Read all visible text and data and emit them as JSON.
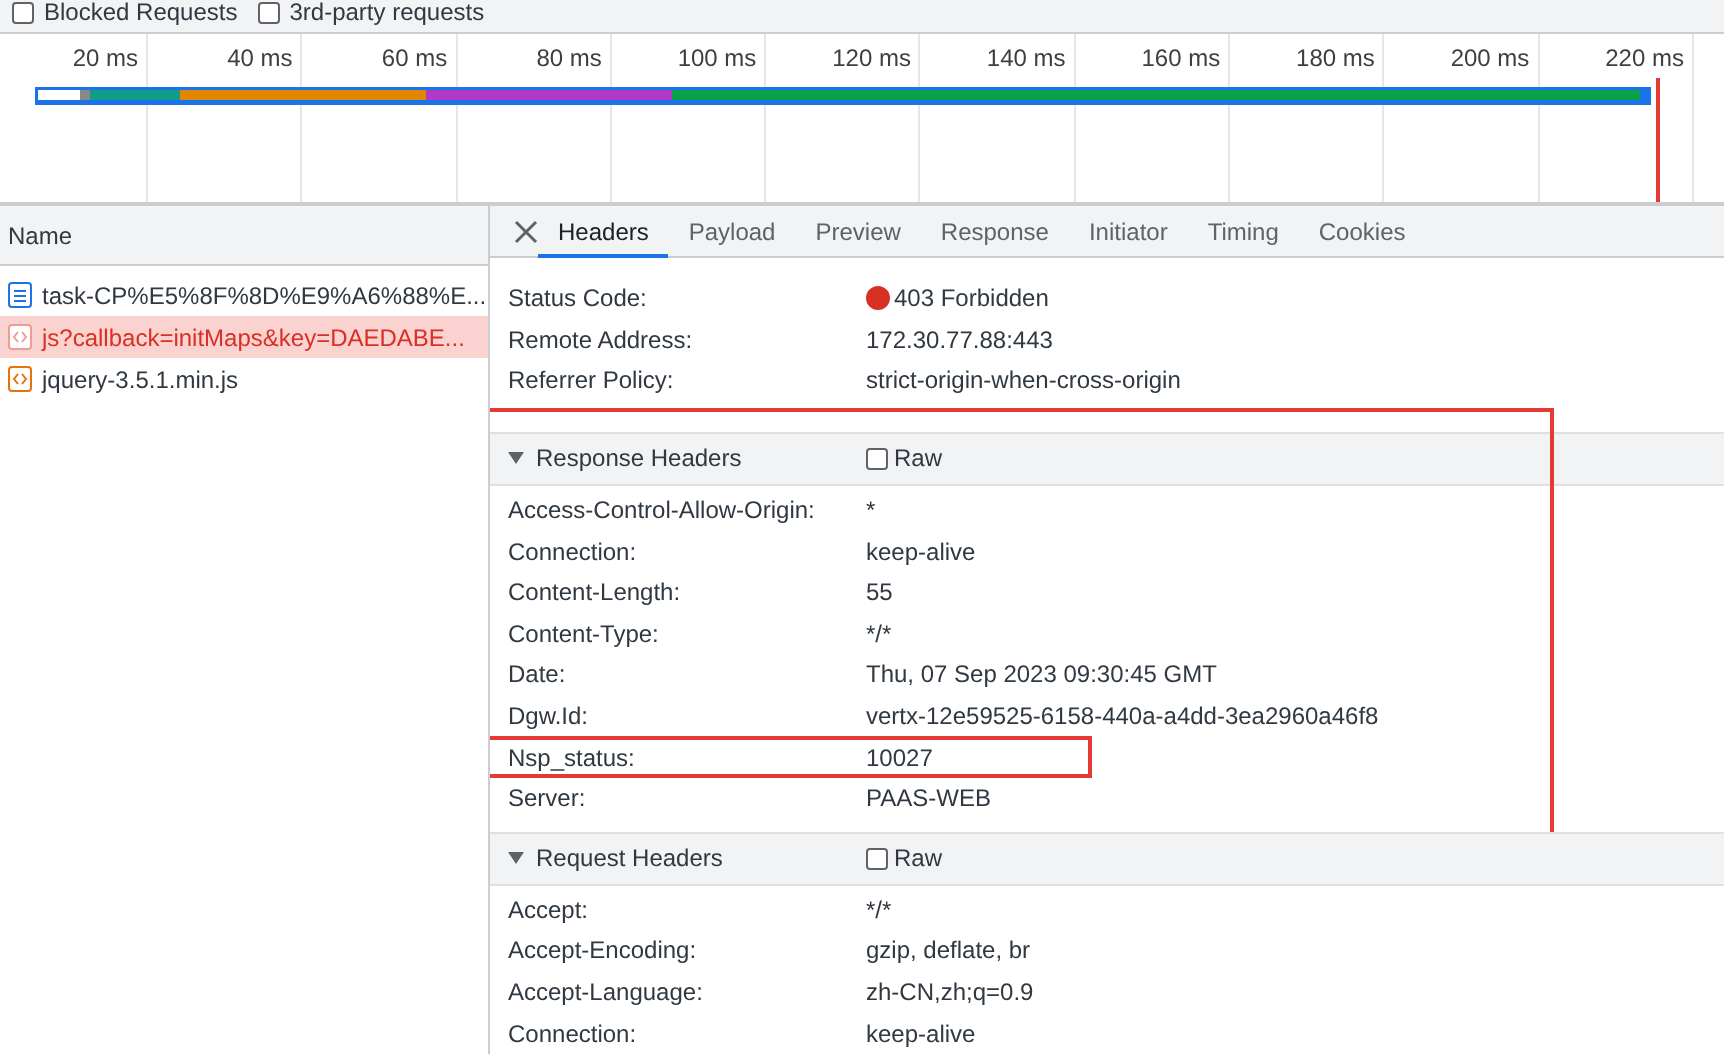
{
  "filters": [
    {
      "label": "Blocked Requests",
      "checked": false
    },
    {
      "label": "3rd-party requests",
      "checked": false
    }
  ],
  "overview": {
    "ticks": [
      "20 ms",
      "40 ms",
      "60 ms",
      "80 ms",
      "100 ms",
      "120 ms",
      "140 ms",
      "160 ms",
      "180 ms",
      "200 ms",
      "220 ms"
    ]
  },
  "requests": {
    "header": "Name",
    "items": [
      {
        "name": "task-CP%E5%8F%8D%E9%A6%88%E...",
        "kind": "document",
        "selected": false,
        "failed": false
      },
      {
        "name": "js?callback=initMaps&key=DAEDABE...",
        "kind": "script",
        "selected": true,
        "failed": true
      },
      {
        "name": "jquery-3.5.1.min.js",
        "kind": "script",
        "selected": false,
        "failed": false
      }
    ]
  },
  "details": {
    "tabs": [
      {
        "label": "Headers",
        "selected": true
      },
      {
        "label": "Payload",
        "selected": false
      },
      {
        "label": "Preview",
        "selected": false
      },
      {
        "label": "Response",
        "selected": false
      },
      {
        "label": "Initiator",
        "selected": false
      },
      {
        "label": "Timing",
        "selected": false
      },
      {
        "label": "Cookies",
        "selected": false
      }
    ],
    "general": [
      {
        "label": "Status Code:",
        "value": "403 Forbidden",
        "color": "#d93025"
      },
      {
        "label": "Remote Address:",
        "value": "172.30.77.88:443"
      },
      {
        "label": "Referrer Policy:",
        "value": "strict-origin-when-cross-origin"
      }
    ],
    "sections": [
      {
        "title": "Response Headers",
        "expanded": true,
        "raw_label": "Raw",
        "raw": false,
        "highlighted": true,
        "rows": [
          {
            "label": "Access-Control-Allow-Origin:",
            "value": "*",
            "highlighted": false
          },
          {
            "label": "Connection:",
            "value": "keep-alive",
            "highlighted": false
          },
          {
            "label": "Content-Length:",
            "value": "55",
            "highlighted": false
          },
          {
            "label": "Content-Type:",
            "value": "*/*",
            "highlighted": false
          },
          {
            "label": "Date:",
            "value": "Thu, 07 Sep 2023 09:30:45 GMT",
            "highlighted": false
          },
          {
            "label": "Dgw.Id:",
            "value": "vertx-12e59525-6158-440a-a4dd-3ea2960a46f8",
            "highlighted": false
          },
          {
            "label": "Nsp_status:",
            "value": "10027",
            "highlighted": true
          },
          {
            "label": "Server:",
            "value": "PAAS-WEB",
            "highlighted": false
          }
        ]
      },
      {
        "title": "Request Headers",
        "expanded": true,
        "raw_label": "Raw",
        "raw": false,
        "highlighted": false,
        "rows": [
          {
            "label": "Accept:",
            "value": "*/*",
            "highlighted": false
          },
          {
            "label": "Accept-Encoding:",
            "value": "gzip, deflate, br",
            "highlighted": false
          },
          {
            "label": "Accept-Language:",
            "value": "zh-CN,zh;q=0.9",
            "highlighted": false
          },
          {
            "label": "Connection:",
            "value": "keep-alive",
            "highlighted": false
          }
        ]
      }
    ]
  }
}
